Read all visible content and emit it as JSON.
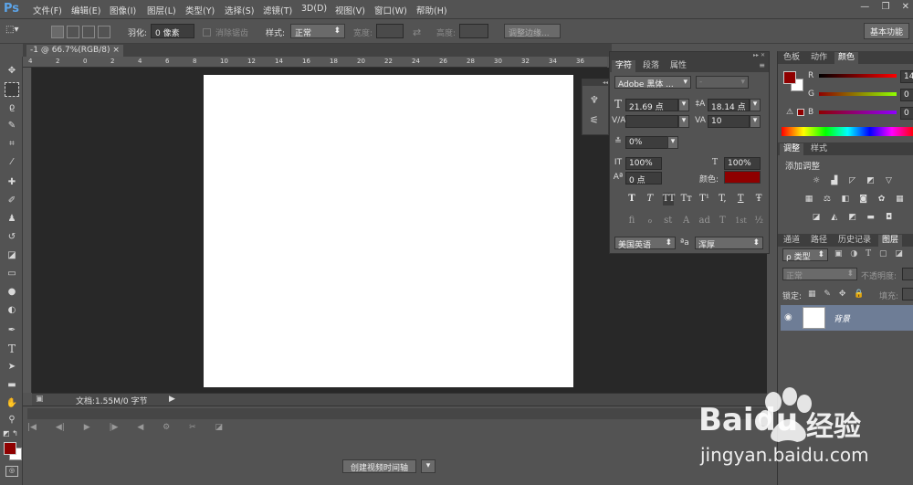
{
  "app": {
    "logo": "Ps"
  },
  "menus": [
    "文件(F)",
    "编辑(E)",
    "图像(I)",
    "图层(L)",
    "类型(Y)",
    "选择(S)",
    "滤镜(T)",
    "3D(D)",
    "视图(V)",
    "窗口(W)",
    "帮助(H)"
  ],
  "window_controls": [
    "—",
    "❐",
    "✕"
  ],
  "options": {
    "feather_label": "羽化:",
    "feather_value": "0 像素",
    "antialias_label": "消除锯齿",
    "style_label": "样式:",
    "style_value": "正常",
    "width_label": "宽度:",
    "height_label": "高度:",
    "refine_edge": "调整边缘...",
    "workspace": "基本功能"
  },
  "document": {
    "tab_title": "-1 @ 66.7%(RGB/8)",
    "ruler_ticks": [
      "4",
      "2",
      "0",
      "2",
      "4",
      "6",
      "8",
      "10",
      "12",
      "14",
      "16",
      "18",
      "20",
      "22",
      "24",
      "26",
      "28",
      "30",
      "32",
      "34",
      "36"
    ],
    "status": "文档:1.55M/0 字节"
  },
  "timeline": {
    "create_button": "创建视频时间轴"
  },
  "character_panel": {
    "tabs": [
      "字符",
      "段落",
      "属性"
    ],
    "font_family": "Adobe 黑体 ...",
    "font_style": "-",
    "font_size": "21.69 点",
    "leading": "18.14 点",
    "kerning": "",
    "tracking": "10",
    "scale_percent": "0%",
    "vertical_scale": "100%",
    "horizontal_scale": "100%",
    "baseline_shift": "0 点",
    "color_label": "颜色:",
    "text_color": "#8f0000",
    "style_buttons": [
      "T",
      "T",
      "TT",
      "Tт",
      "T¹",
      "T,",
      "T",
      "Ŧ"
    ],
    "opentype_buttons": [
      "fi",
      "ℴ",
      "st",
      "A",
      "ad",
      "T",
      "1st",
      "½"
    ],
    "language": "美国英语",
    "aa_icon": "ªa",
    "antialias": "浑厚"
  },
  "color_panel": {
    "tabs": [
      "色板",
      "动作",
      "颜色"
    ],
    "channels": [
      "R",
      "G",
      "B"
    ],
    "values": [
      "14",
      "0",
      "0"
    ],
    "foreground": "#8f0000",
    "background": "#ffffff"
  },
  "adjust_panel": {
    "tabs": [
      "调整",
      "样式"
    ],
    "title": "添加调整"
  },
  "layers_panel": {
    "tabs": [
      "通道",
      "路径",
      "历史记录",
      "图层"
    ],
    "filter_label": "ρ 类型",
    "blend_mode": "正常",
    "opacity_label": "不透明度:",
    "lock_label": "锁定:",
    "fill_label": "填充:",
    "layer_name": "背景"
  },
  "watermark": {
    "brand": "Baidu",
    "cn": "经验",
    "url": "jingyan.baidu.com"
  }
}
